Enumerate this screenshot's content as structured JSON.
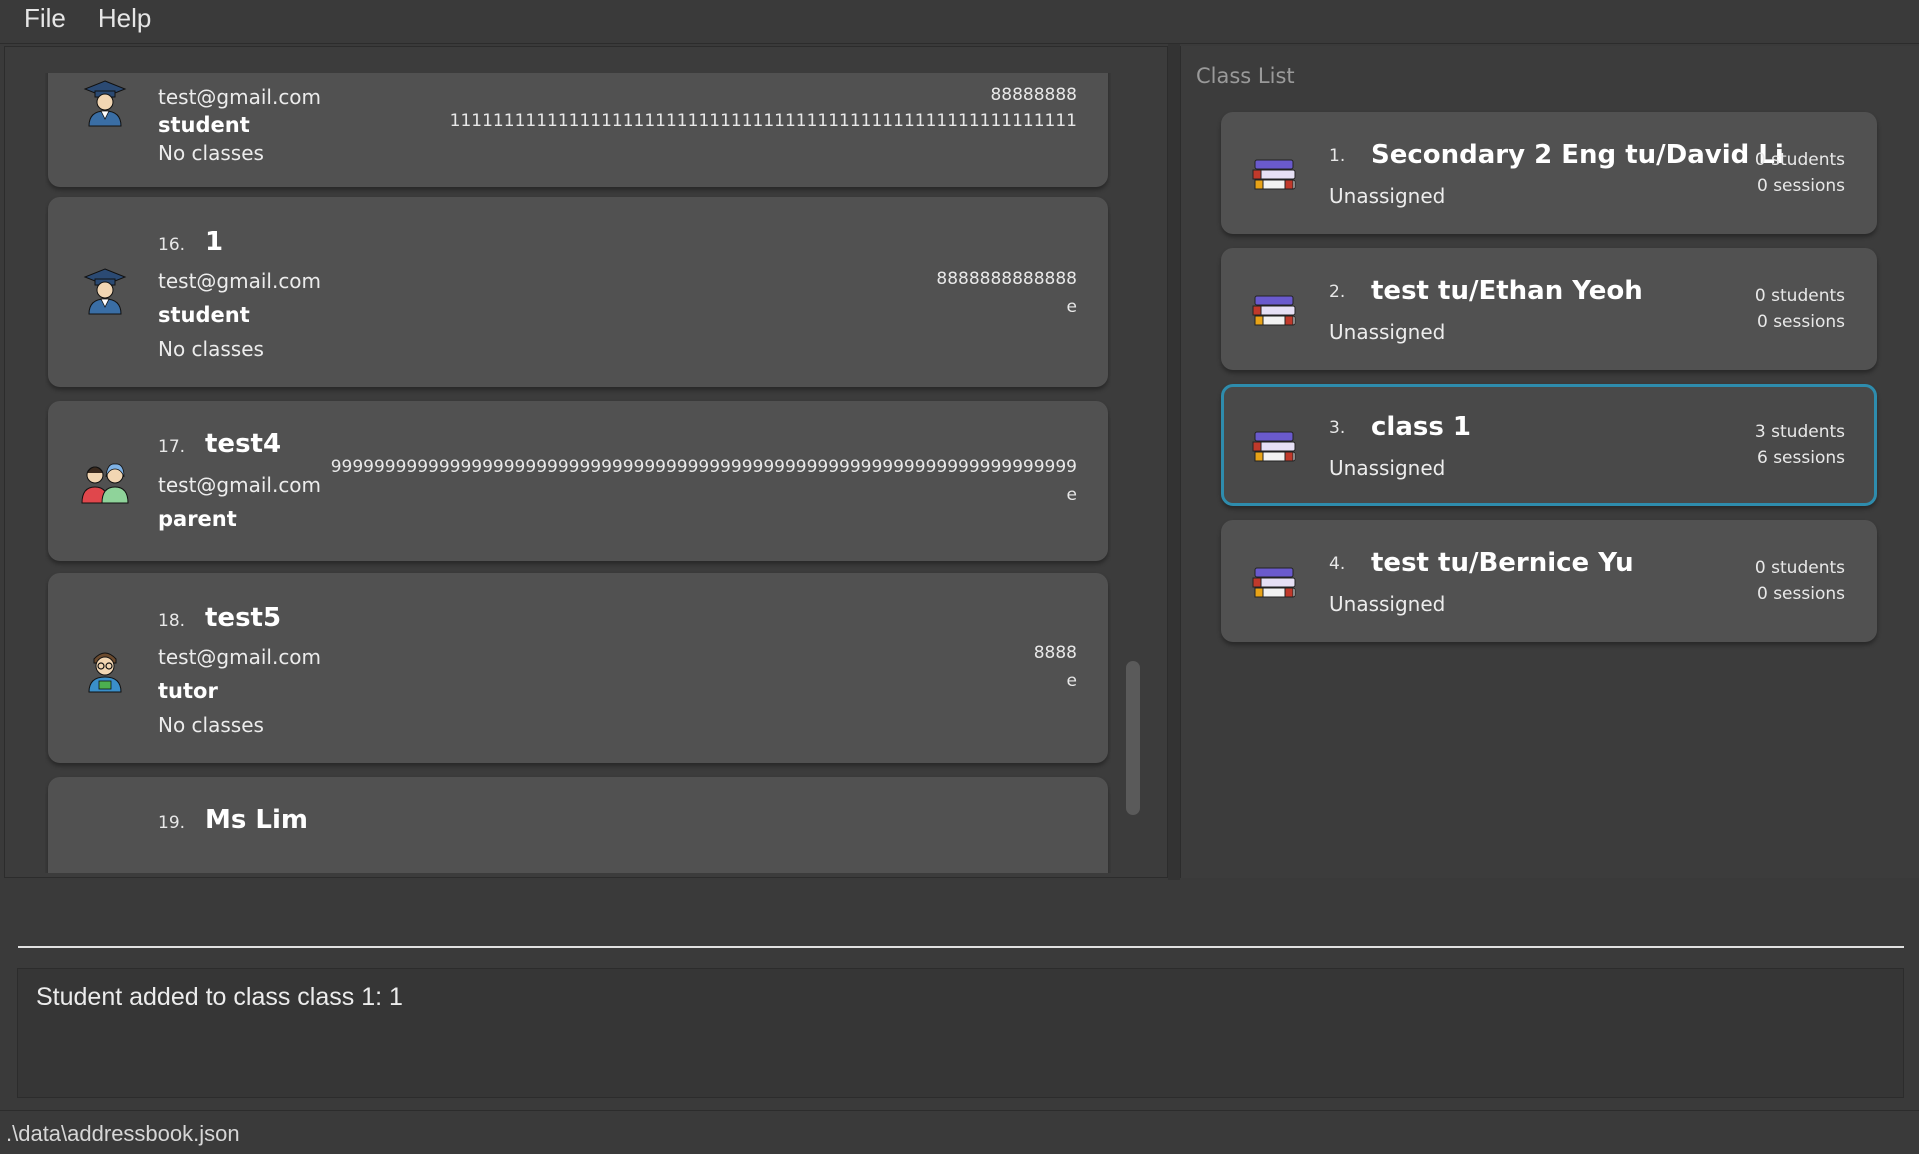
{
  "menu": {
    "file": "File",
    "help": "Help"
  },
  "persons": [
    {
      "index": "",
      "name": "",
      "email": "test@gmail.com",
      "role": "student",
      "classes": "No classes",
      "phone": "88888888",
      "extra": "1111111111111111111111111111111111111111111111111111111111",
      "avatar": "student-icon"
    },
    {
      "index": "16.",
      "name": "1",
      "email": "test@gmail.com",
      "role": "student",
      "classes": "No classes",
      "phone": "8888888888888",
      "extra": "e",
      "avatar": "student-icon"
    },
    {
      "index": "17.",
      "name": "test4",
      "email": "test@gmail.com",
      "role": "parent",
      "classes": "",
      "phone": "999999999999999999999999999999999999999999999999999999999999999999999",
      "extra": "e",
      "avatar": "parent-icon"
    },
    {
      "index": "18.",
      "name": "test5",
      "email": "test@gmail.com",
      "role": "tutor",
      "classes": "No classes",
      "phone": "8888",
      "extra": "e",
      "avatar": "tutor-icon"
    },
    {
      "index": "19.",
      "name": "Ms Lim",
      "email": "",
      "role": "",
      "classes": "",
      "phone": "",
      "extra": "",
      "avatar": ""
    }
  ],
  "class_list": {
    "title": "Class List",
    "items": [
      {
        "index": "1.",
        "name": "Secondary 2 Eng tu/David Li",
        "tutor": "Unassigned",
        "students": "0 students",
        "sessions": "0 sessions",
        "selected": false
      },
      {
        "index": "2.",
        "name": "test tu/Ethan Yeoh",
        "tutor": "Unassigned",
        "students": "0 students",
        "sessions": "0 sessions",
        "selected": false
      },
      {
        "index": "3.",
        "name": "class 1",
        "tutor": "Unassigned",
        "students": "3 students",
        "sessions": "6 sessions",
        "selected": true
      },
      {
        "index": "4.",
        "name": "test tu/Bernice Yu",
        "tutor": "Unassigned",
        "students": "0 students",
        "sessions": "0 sessions",
        "selected": false
      }
    ]
  },
  "command": {
    "value": "",
    "placeholder": ""
  },
  "result": {
    "text": "Student added to class class 1: 1"
  },
  "status": {
    "path": ".\\data\\addressbook.json"
  },
  "colors": {
    "selected_border": "#2e8cad",
    "card_bg": "#515151",
    "app_bg": "#3a3a3a"
  }
}
